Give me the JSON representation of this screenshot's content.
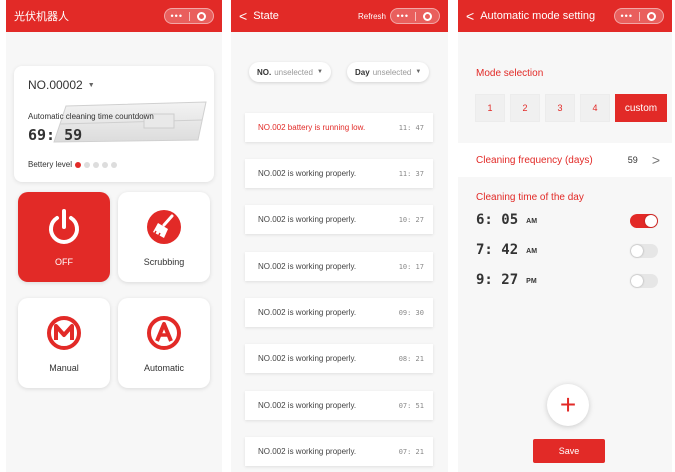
{
  "home": {
    "title": "光伏机器人",
    "device_id": "NO.00002",
    "countdown_label": "Automatic cleaning time countdown",
    "countdown_time": "69: 59",
    "battery_label": "Bettery level",
    "battery_level_dots": 1,
    "battery_total_dots": 5,
    "tiles": {
      "off": "OFF",
      "scrubbing": "Scrubbing",
      "manual": "Manual",
      "automatic": "Automatic"
    }
  },
  "state": {
    "title": "State",
    "refresh_label": "Refresh",
    "filter_no_label": "NO.",
    "filter_no_value": "unselected",
    "filter_day_label": "Day",
    "filter_day_value": "unselected",
    "logs": [
      {
        "message": "NO.002 battery is running low.",
        "time": "11: 47"
      },
      {
        "message": "NO.002 is working properly.",
        "time": "11: 37"
      },
      {
        "message": "NO.002 is working properly.",
        "time": "10: 27"
      },
      {
        "message": "NO.002 is working properly.",
        "time": "10: 17"
      },
      {
        "message": "NO.002 is working properly.",
        "time": "09: 30"
      },
      {
        "message": "NO.002 is working properly.",
        "time": "08: 21"
      },
      {
        "message": "NO.002 is working properly.",
        "time": "07: 51"
      },
      {
        "message": "NO.002 is working properly.",
        "time": "07: 21"
      }
    ]
  },
  "auto": {
    "title": "Automatic mode setting",
    "mode_label": "Mode selection",
    "modes": [
      "1",
      "2",
      "3",
      "4",
      "custom"
    ],
    "selected_mode": "custom",
    "frequency_label": "Cleaning frequency (days)",
    "frequency_value": "59",
    "time_label": "Cleaning time of the day",
    "times": [
      {
        "time": "6: 05",
        "ampm": "AM",
        "enabled": true
      },
      {
        "time": "7: 42",
        "ampm": "AM",
        "enabled": false
      },
      {
        "time": "9: 27",
        "ampm": "PM",
        "enabled": false
      }
    ],
    "add_label": "+",
    "save_label": "Save"
  },
  "colors": {
    "accent": "#e22a27",
    "background": "#f7f7f7"
  }
}
